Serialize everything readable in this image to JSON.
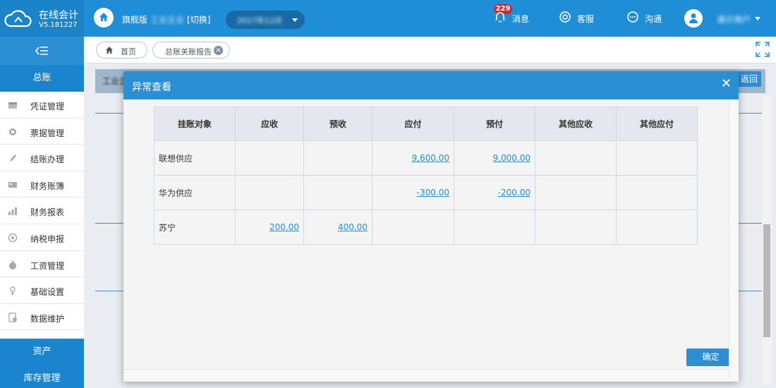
{
  "header": {
    "app_name": "在线会计",
    "version": "V5.181227",
    "edition_label": "旗舰版",
    "company_name": "工业企业",
    "switch_label": "[切换]",
    "period": "2017年12月",
    "messages_label": "消息",
    "messages_count": "229",
    "service_label": "客服",
    "chat_label": "沟通",
    "username": "演示用户"
  },
  "sidebar": {
    "main_group": "总账",
    "items": [
      {
        "label": "凭证管理",
        "icon": "voucher-icon"
      },
      {
        "label": "票据管理",
        "icon": "bills-icon"
      },
      {
        "label": "结账办理",
        "icon": "pencil-icon"
      },
      {
        "label": "财务账簿",
        "icon": "ledger-icon"
      },
      {
        "label": "财务报表",
        "icon": "bar-chart-icon"
      },
      {
        "label": "纳税申报",
        "icon": "tax-icon"
      },
      {
        "label": "工资管理",
        "icon": "money-bag-icon"
      },
      {
        "label": "基础设置",
        "icon": "settings-icon"
      },
      {
        "label": "数据维护",
        "icon": "data-icon"
      }
    ],
    "groups": [
      "资产",
      "库存管理"
    ]
  },
  "tabs": {
    "home": "首页",
    "active": "总账关账报告"
  },
  "page": {
    "title": "工业企业",
    "back_label": "返回"
  },
  "modal": {
    "title": "异常查看",
    "confirm_label": "确定",
    "table": {
      "headers": [
        "挂账对象",
        "应收",
        "预收",
        "应付",
        "预付",
        "其他应收",
        "其他应付"
      ],
      "rows": [
        [
          "联想供应",
          "",
          "",
          "9,600.00",
          "9,000.00",
          "",
          ""
        ],
        [
          "华为供应",
          "",
          "",
          "-300.00",
          "-200.00",
          "",
          ""
        ],
        [
          "苏宁",
          "200.00",
          "400.00",
          "",
          "",
          "",
          ""
        ]
      ]
    }
  },
  "colors": {
    "primary": "#1f8ed6",
    "sidebar_group": "#1a84cf",
    "badge": "#d3262e",
    "table_header": "#e4e7ee"
  }
}
